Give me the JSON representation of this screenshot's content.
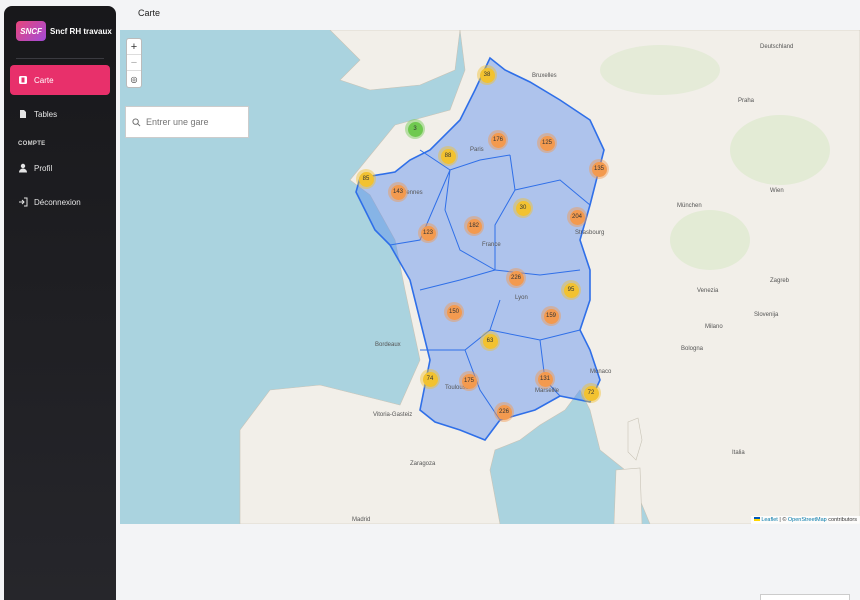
{
  "app": {
    "brand_logo": "SNCF",
    "brand_name": "Sncf RH travaux"
  },
  "sidebar": {
    "items": [
      {
        "label": "Carte",
        "icon": "map-icon",
        "active": true
      },
      {
        "label": "Tables",
        "icon": "tables-icon",
        "active": false
      }
    ],
    "section_label": "COMPTE",
    "account_items": [
      {
        "label": "Profil",
        "icon": "user-icon"
      },
      {
        "label": "Déconnexion",
        "icon": "logout-icon"
      }
    ]
  },
  "page": {
    "title": "Carte"
  },
  "map": {
    "zoom_in": "+",
    "zoom_out": "−",
    "search_placeholder": "Entrer une gare",
    "attribution_leaflet": "Leaflet",
    "attribution_sep": " | © ",
    "attribution_osm": "OpenStreetMap",
    "attribution_tail": " contributors",
    "clusters": [
      {
        "label": "38",
        "color": "yellow"
      },
      {
        "label": "3",
        "color": "green"
      },
      {
        "label": "88",
        "color": "yellow"
      },
      {
        "label": "176",
        "color": "orange"
      },
      {
        "label": "125",
        "color": "orange"
      },
      {
        "label": "85",
        "color": "yellow"
      },
      {
        "label": "143",
        "color": "orange"
      },
      {
        "label": "123",
        "color": "orange"
      },
      {
        "label": "182",
        "color": "orange"
      },
      {
        "label": "135",
        "color": "orange"
      },
      {
        "label": "30",
        "color": "yellow"
      },
      {
        "label": "204",
        "color": "orange"
      },
      {
        "label": "226",
        "color": "orange"
      },
      {
        "label": "95",
        "color": "yellow"
      },
      {
        "label": "150",
        "color": "orange"
      },
      {
        "label": "159",
        "color": "orange"
      },
      {
        "label": "63",
        "color": "yellow"
      },
      {
        "label": "74",
        "color": "yellow"
      },
      {
        "label": "175",
        "color": "orange"
      },
      {
        "label": "131",
        "color": "orange"
      },
      {
        "label": "72",
        "color": "yellow"
      },
      {
        "label": "226",
        "color": "orange"
      }
    ],
    "cities": [
      "Rennes",
      "Paris",
      "France",
      "Bordeaux",
      "Toulouse",
      "Lyon",
      "Marseille",
      "Strasbourg",
      "Deutschland",
      "Italia",
      "Madrid",
      "Zaragoza",
      "Bologna",
      "Milano",
      "Monaco",
      "Bruxelles",
      "München",
      "Praha",
      "Wien",
      "Vitoria-Gasteiz",
      "Venezia",
      "Zagreb",
      "Slovenija"
    ]
  }
}
